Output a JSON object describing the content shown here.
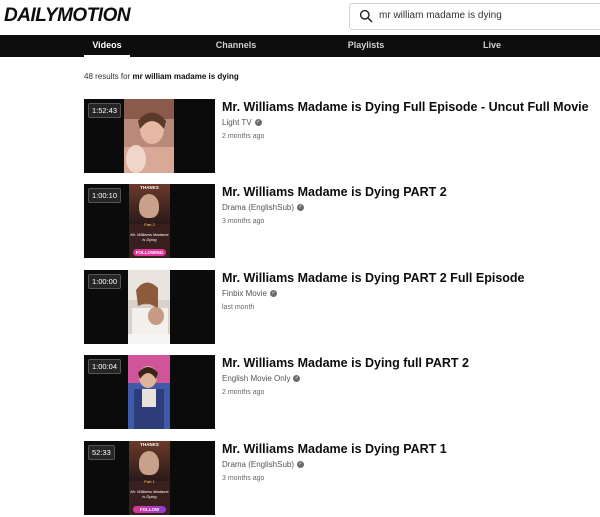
{
  "site": {
    "logo_text": "DAILYMOTION"
  },
  "search": {
    "query": "mr william madame is dying"
  },
  "tabs": [
    {
      "label": "Videos",
      "active": true
    },
    {
      "label": "Channels",
      "active": false
    },
    {
      "label": "Playlists",
      "active": false
    },
    {
      "label": "Live",
      "active": false
    }
  ],
  "results": {
    "count_prefix": "48 results for",
    "query": "mr william madame is dying"
  },
  "videos": [
    {
      "duration": "1:52:43",
      "title": "Mr. Williams Madame is Dying Full Episode - Uncut Full Movie",
      "channel": "Light TV",
      "age": "2 months ago"
    },
    {
      "duration": "1:00:10",
      "title": "Mr. Williams Madame is Dying PART 2",
      "channel": "Drama (EnglishSub)",
      "age": "3 months ago",
      "thumb_badge": "FOLLOWING",
      "thumb_top": "THANKS",
      "thumb_part": "Part 2",
      "thumb_title": "Mr. Williams Madame is Dying"
    },
    {
      "duration": "1:00:00",
      "title": "Mr. Williams Madame is Dying PART 2 Full Episode",
      "channel": "Finbix Movie",
      "age": "last month"
    },
    {
      "duration": "1:00:04",
      "title": "Mr. Williams Madame is Dying full PART 2",
      "channel": "English Movie Only",
      "age": "2 months ago"
    },
    {
      "duration": "52:33",
      "title": "Mr. Williams Madame is Dying PART 1",
      "channel": "Drama (EnglishSub)",
      "age": "3 months ago",
      "thumb_badge": "FOLLOW",
      "thumb_top": "THANKS",
      "thumb_part": "Part 1",
      "thumb_title": "Mr. Williams Madame is Dying"
    }
  ],
  "colors": {
    "nav_bg": "#0d0d0d",
    "accent_pink": "#e0349a",
    "follow_purple": "#8b3fd1"
  }
}
